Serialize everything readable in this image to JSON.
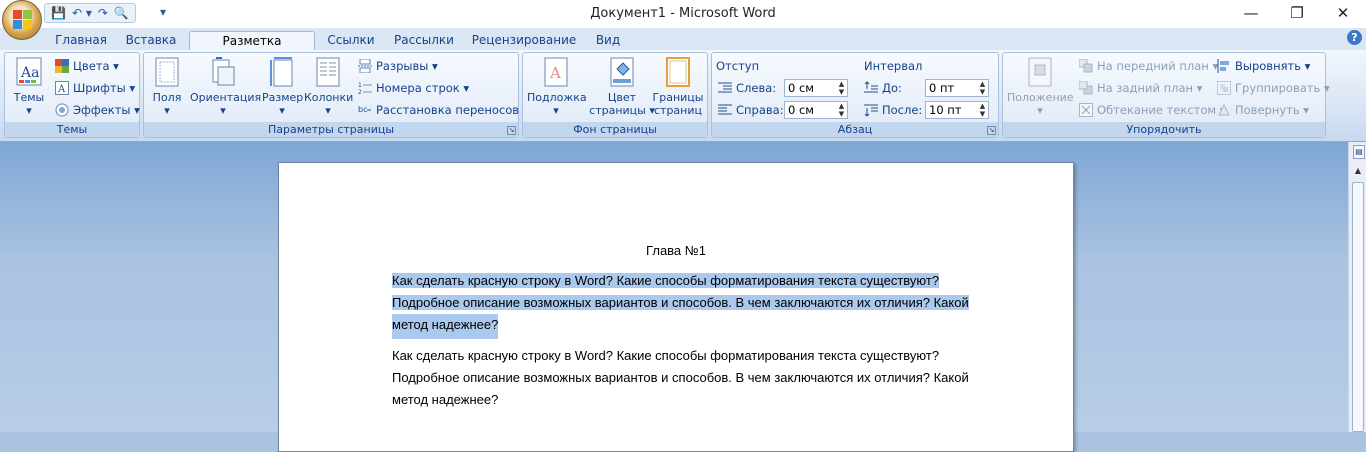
{
  "window": {
    "title": "Документ1 - Microsoft Word",
    "minimize": "—",
    "restore": "❐",
    "close": "✕"
  },
  "qat": {
    "save": "💾",
    "undo": "↶ ▾",
    "redo": "↷",
    "print_preview": "🔍",
    "customize": "▾"
  },
  "tabs": [
    "Главная",
    "Вставка",
    "Разметка страницы",
    "Ссылки",
    "Рассылки",
    "Рецензирование",
    "Вид"
  ],
  "active_tab": "Разметка страницы",
  "help": "?",
  "groups": {
    "themes": {
      "label": "Темы",
      "themes_button": "Темы",
      "colors": "Цвета ▾",
      "fonts": "Шрифты ▾",
      "effects": "Эффекты ▾"
    },
    "page_setup": {
      "label": "Параметры страницы",
      "margins": "Поля",
      "orientation": "Ориентация",
      "size": "Размер",
      "columns": "Колонки",
      "breaks": "Разрывы ▾",
      "line_numbers": "Номера строк ▾",
      "hyphenation": "Расстановка переносов ▾"
    },
    "page_background": {
      "label": "Фон страницы",
      "watermark": "Подложка",
      "page_color_1": "Цвет",
      "page_color_2": "страницы ▾",
      "page_borders_1": "Границы",
      "page_borders_2": "страниц"
    },
    "paragraph": {
      "label": "Абзац",
      "indent_header": "Отступ",
      "left_label": "Слева:",
      "left_value": "0 см",
      "right_label": "Справа:",
      "right_value": "0 см",
      "spacing_header": "Интервал",
      "before_label": "До:",
      "before_value": "0 пт",
      "after_label": "После:",
      "after_value": "10 пт"
    },
    "arrange": {
      "label": "Упорядочить",
      "position": "Положение",
      "bring_front": "На передний план ▾",
      "send_back": "На задний план ▾",
      "text_wrap": "Обтекание текстом ▾",
      "align": "Выровнять ▾",
      "group": "Группировать ▾",
      "rotate": "Повернуть ▾"
    }
  },
  "document": {
    "heading": "Глава №1",
    "para1_lines": [
      "Как сделать красную строку в Word? Какие способы форматирования текста существуют?",
      "Подробное описание возможных вариантов  и способов. В чем заключаются их отличия? Какой",
      "метод надежнее?"
    ],
    "para2_lines": [
      "Как сделать красную строку в Word? Какие способы форматирования текста существуют?",
      "Подробное описание возможных вариантов  и способов. В чем заключаются их отличия? Какой",
      "метод надежнее?"
    ]
  },
  "colors": {
    "selection": "#a9c9ee",
    "ribbon_text": "#15428b",
    "workspace": "#a9c3e1"
  }
}
